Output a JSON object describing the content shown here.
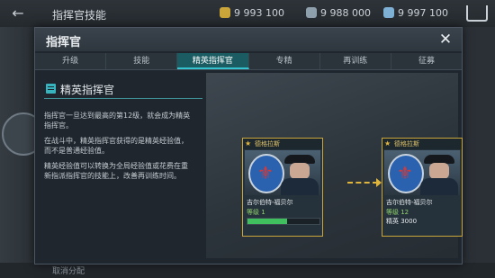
{
  "background": {
    "back_label": "←",
    "title": "指挥官技能",
    "currencies": [
      "9 993 100",
      "9 988 000",
      "9 997 100"
    ],
    "currency_colors": [
      "#c9a53a",
      "#8fa0ad",
      "#7fb0d6"
    ],
    "bottom_text": "取消分配"
  },
  "modal": {
    "title": "指挥官",
    "close_label": "✕",
    "tabs": [
      "升级",
      "技能",
      "精英指挥官",
      "专精",
      "再训练",
      "征募"
    ],
    "active_tab": 2
  },
  "info": {
    "title": "精英指挥官",
    "paragraphs": [
      "指挥官一旦达到最高的第12级，就会成为精英指挥官。",
      "在战斗中，精英指挥官获得的是精英经验值，而不是普通经验值。",
      "精英经验值可以转换为全局经验值或花费在重新指派指挥官的技能上，改善再训练时间。"
    ]
  },
  "cards": [
    {
      "rank": "德格拉斯",
      "name": "吉尔伯特-福贝尔",
      "level": "等级 1",
      "xp_text": "",
      "progress": 0.55
    },
    {
      "rank": "德格拉斯",
      "name": "吉尔伯特-福贝尔",
      "level": "等级 12",
      "xp_text": "精英 3000",
      "progress": 0
    }
  ],
  "colors": {
    "accent": "#35c3cf",
    "card_border": "#c9a53a"
  }
}
